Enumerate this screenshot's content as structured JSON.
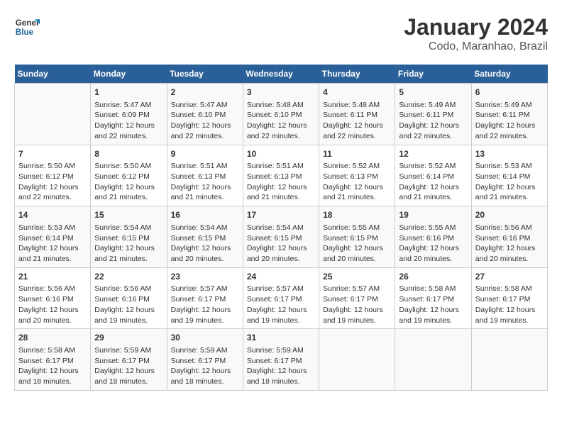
{
  "header": {
    "logo_line1": "General",
    "logo_line2": "Blue",
    "title": "January 2024",
    "subtitle": "Codo, Maranhao, Brazil"
  },
  "days_of_week": [
    "Sunday",
    "Monday",
    "Tuesday",
    "Wednesday",
    "Thursday",
    "Friday",
    "Saturday"
  ],
  "weeks": [
    [
      {
        "day": "",
        "info": ""
      },
      {
        "day": "1",
        "info": "Sunrise: 5:47 AM\nSunset: 6:09 PM\nDaylight: 12 hours\nand 22 minutes."
      },
      {
        "day": "2",
        "info": "Sunrise: 5:47 AM\nSunset: 6:10 PM\nDaylight: 12 hours\nand 22 minutes."
      },
      {
        "day": "3",
        "info": "Sunrise: 5:48 AM\nSunset: 6:10 PM\nDaylight: 12 hours\nand 22 minutes."
      },
      {
        "day": "4",
        "info": "Sunrise: 5:48 AM\nSunset: 6:11 PM\nDaylight: 12 hours\nand 22 minutes."
      },
      {
        "day": "5",
        "info": "Sunrise: 5:49 AM\nSunset: 6:11 PM\nDaylight: 12 hours\nand 22 minutes."
      },
      {
        "day": "6",
        "info": "Sunrise: 5:49 AM\nSunset: 6:11 PM\nDaylight: 12 hours\nand 22 minutes."
      }
    ],
    [
      {
        "day": "7",
        "info": "Sunrise: 5:50 AM\nSunset: 6:12 PM\nDaylight: 12 hours\nand 22 minutes."
      },
      {
        "day": "8",
        "info": "Sunrise: 5:50 AM\nSunset: 6:12 PM\nDaylight: 12 hours\nand 21 minutes."
      },
      {
        "day": "9",
        "info": "Sunrise: 5:51 AM\nSunset: 6:13 PM\nDaylight: 12 hours\nand 21 minutes."
      },
      {
        "day": "10",
        "info": "Sunrise: 5:51 AM\nSunset: 6:13 PM\nDaylight: 12 hours\nand 21 minutes."
      },
      {
        "day": "11",
        "info": "Sunrise: 5:52 AM\nSunset: 6:13 PM\nDaylight: 12 hours\nand 21 minutes."
      },
      {
        "day": "12",
        "info": "Sunrise: 5:52 AM\nSunset: 6:14 PM\nDaylight: 12 hours\nand 21 minutes."
      },
      {
        "day": "13",
        "info": "Sunrise: 5:53 AM\nSunset: 6:14 PM\nDaylight: 12 hours\nand 21 minutes."
      }
    ],
    [
      {
        "day": "14",
        "info": "Sunrise: 5:53 AM\nSunset: 6:14 PM\nDaylight: 12 hours\nand 21 minutes."
      },
      {
        "day": "15",
        "info": "Sunrise: 5:54 AM\nSunset: 6:15 PM\nDaylight: 12 hours\nand 21 minutes."
      },
      {
        "day": "16",
        "info": "Sunrise: 5:54 AM\nSunset: 6:15 PM\nDaylight: 12 hours\nand 20 minutes."
      },
      {
        "day": "17",
        "info": "Sunrise: 5:54 AM\nSunset: 6:15 PM\nDaylight: 12 hours\nand 20 minutes."
      },
      {
        "day": "18",
        "info": "Sunrise: 5:55 AM\nSunset: 6:15 PM\nDaylight: 12 hours\nand 20 minutes."
      },
      {
        "day": "19",
        "info": "Sunrise: 5:55 AM\nSunset: 6:16 PM\nDaylight: 12 hours\nand 20 minutes."
      },
      {
        "day": "20",
        "info": "Sunrise: 5:56 AM\nSunset: 6:16 PM\nDaylight: 12 hours\nand 20 minutes."
      }
    ],
    [
      {
        "day": "21",
        "info": "Sunrise: 5:56 AM\nSunset: 6:16 PM\nDaylight: 12 hours\nand 20 minutes."
      },
      {
        "day": "22",
        "info": "Sunrise: 5:56 AM\nSunset: 6:16 PM\nDaylight: 12 hours\nand 19 minutes."
      },
      {
        "day": "23",
        "info": "Sunrise: 5:57 AM\nSunset: 6:17 PM\nDaylight: 12 hours\nand 19 minutes."
      },
      {
        "day": "24",
        "info": "Sunrise: 5:57 AM\nSunset: 6:17 PM\nDaylight: 12 hours\nand 19 minutes."
      },
      {
        "day": "25",
        "info": "Sunrise: 5:57 AM\nSunset: 6:17 PM\nDaylight: 12 hours\nand 19 minutes."
      },
      {
        "day": "26",
        "info": "Sunrise: 5:58 AM\nSunset: 6:17 PM\nDaylight: 12 hours\nand 19 minutes."
      },
      {
        "day": "27",
        "info": "Sunrise: 5:58 AM\nSunset: 6:17 PM\nDaylight: 12 hours\nand 19 minutes."
      }
    ],
    [
      {
        "day": "28",
        "info": "Sunrise: 5:58 AM\nSunset: 6:17 PM\nDaylight: 12 hours\nand 18 minutes."
      },
      {
        "day": "29",
        "info": "Sunrise: 5:59 AM\nSunset: 6:17 PM\nDaylight: 12 hours\nand 18 minutes."
      },
      {
        "day": "30",
        "info": "Sunrise: 5:59 AM\nSunset: 6:17 PM\nDaylight: 12 hours\nand 18 minutes."
      },
      {
        "day": "31",
        "info": "Sunrise: 5:59 AM\nSunset: 6:17 PM\nDaylight: 12 hours\nand 18 minutes."
      },
      {
        "day": "",
        "info": ""
      },
      {
        "day": "",
        "info": ""
      },
      {
        "day": "",
        "info": ""
      }
    ]
  ]
}
